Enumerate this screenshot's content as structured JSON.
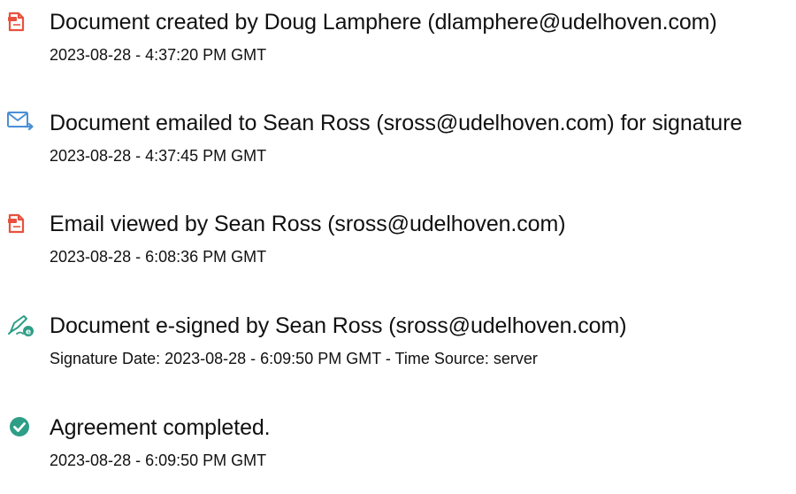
{
  "events": [
    {
      "icon": "document-created-icon",
      "title": "Document created by Doug Lamphere (dlamphere@udelhoven.com)",
      "detail": "2023-08-28 - 4:37:20 PM GMT"
    },
    {
      "icon": "email-sent-icon",
      "title": "Document emailed to Sean Ross (sross@udelhoven.com) for signature",
      "detail": "2023-08-28 - 4:37:45 PM GMT"
    },
    {
      "icon": "document-viewed-icon",
      "title": "Email viewed by Sean Ross (sross@udelhoven.com)",
      "detail": "2023-08-28 - 6:08:36 PM GMT"
    },
    {
      "icon": "esign-pen-icon",
      "title": "Document e-signed by Sean Ross (sross@udelhoven.com)",
      "detail": "Signature Date: 2023-08-28 - 6:09:50 PM GMT - Time Source: server"
    },
    {
      "icon": "check-circle-icon",
      "title": "Agreement completed.",
      "detail": "2023-08-28 - 6:09:50 PM GMT"
    }
  ],
  "colors": {
    "document_icon": "#e8513f",
    "email_icon": "#4a8fd6",
    "esign_icon": "#2e9e86",
    "complete_icon": "#2e9e86",
    "text": "#111111"
  }
}
